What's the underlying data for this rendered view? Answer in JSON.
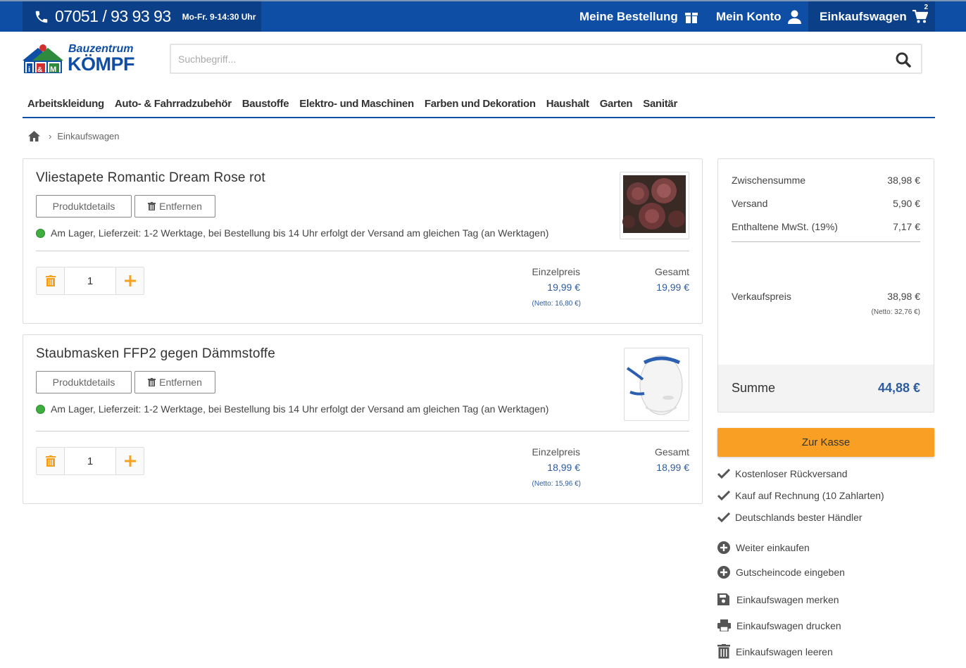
{
  "topbar": {
    "phone": "07051 / 93 93 93",
    "hours": "Mo-Fr. 9-14:30 Uhr",
    "my_order": "Meine Bestellung",
    "my_account": "Mein Konto",
    "cart": "Einkaufswagen",
    "cart_count": "2"
  },
  "logo": {
    "line1": "Bauzentrum",
    "line2": "KÖMPF",
    "badge": "i&M"
  },
  "search": {
    "placeholder": "Suchbegriff..."
  },
  "nav": {
    "items": [
      "Arbeitskleidung",
      "Auto- & Fahrradzubehör",
      "Baustoffe",
      "Elektro- und Maschinen",
      "Farben und Dekoration",
      "Haushalt",
      "Garten",
      "Sanitär"
    ]
  },
  "breadcrumb": {
    "current": "Einkaufswagen"
  },
  "items": [
    {
      "title": "Vliestapete Romantic Dream Rose rot",
      "details_label": "Produktdetails",
      "remove_label": "Entfernen",
      "stock": "Am Lager, Lieferzeit: 1-2 Werktage, bei Bestellung bis 14 Uhr erfolgt der Versand am gleichen Tag (an Werktagen)",
      "qty": "1",
      "unit_label": "Einzelpreis",
      "unit_price": "19,99 €",
      "unit_net": "(Netto: 16,80 €)",
      "total_label": "Gesamt",
      "total_price": "19,99 €"
    },
    {
      "title": "Staubmasken FFP2 gegen Dämmstoffe",
      "details_label": "Produktdetails",
      "remove_label": "Entfernen",
      "stock": "Am Lager, Lieferzeit: 1-2 Werktage, bei Bestellung bis 14 Uhr erfolgt der Versand am gleichen Tag (an Werktagen)",
      "qty": "1",
      "unit_label": "Einzelpreis",
      "unit_price": "18,99 €",
      "unit_net": "(Netto: 15,96 €)",
      "total_label": "Gesamt",
      "total_price": "18,99 €"
    }
  ],
  "summary": {
    "subtotal_label": "Zwischensumme",
    "subtotal": "38,98 €",
    "shipping_label": "Versand",
    "shipping": "5,90 €",
    "vat_label": "Enthaltene MwSt. (19%)",
    "vat": "7,17 €",
    "sale_label": "Verkaufspreis",
    "sale": "38,98 €",
    "sale_net": "(Netto: 32,76 €)",
    "total_label": "Summe",
    "total": "44,88 €"
  },
  "checkout_label": "Zur Kasse",
  "benefits": [
    "Kostenloser Rückversand",
    "Kauf auf Rechnung (10 Zahlarten)",
    "Deutschlands bester Händler"
  ],
  "actions": {
    "continue": "Weiter einkaufen",
    "voucher": "Gutscheincode eingeben",
    "save": "Einkaufswagen merken",
    "print": "Einkaufswagen drucken",
    "clear": "Einkaufswagen leeren"
  },
  "colors": {
    "brand_blue": "#0e4ea4",
    "dark_blue": "#0b3f87",
    "price_blue": "#2d5d9f",
    "checkout_orange": "#f9a024",
    "stock_green": "#3fae3f"
  }
}
